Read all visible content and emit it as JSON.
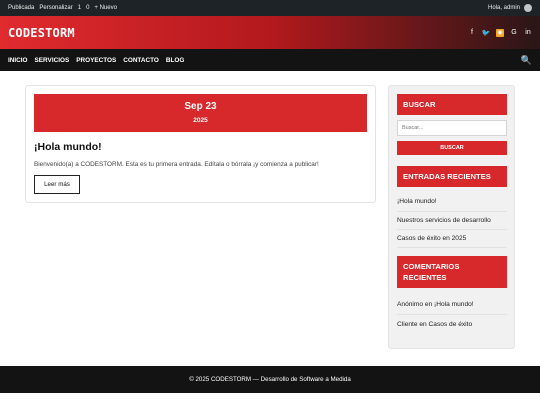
{
  "adminbar": {
    "items": [
      "Publicada",
      "Personalizar",
      "1",
      "0",
      "+ Nuevo"
    ],
    "greeting": "Hola, admin"
  },
  "brand": {
    "logo": "CODESTORM",
    "social": [
      {
        "icon": "facebook-icon",
        "glyph": "f"
      },
      {
        "icon": "twitter-icon",
        "glyph": "🐦"
      },
      {
        "icon": "rss-icon",
        "glyph": "◉"
      },
      {
        "icon": "google-icon",
        "glyph": "G"
      },
      {
        "icon": "linkedin-icon",
        "glyph": "in"
      }
    ]
  },
  "nav": {
    "items": [
      "INICIO",
      "SERVICIOS",
      "PROYECTOS",
      "CONTACTO",
      "BLOG"
    ],
    "search_glyph": "🔍"
  },
  "post": {
    "date_day": "Sep 23",
    "date_year": "2025",
    "title": "¡Hola mundo!",
    "excerpt": "Bienvenido(a) a CODESTORM. Esta es tu primera entrada. Edítala o bórrala ¡y comienza a publicar!",
    "read_more": "Leer más"
  },
  "sidebar": {
    "search_title": "BUSCAR",
    "search_placeholder": "Buscar...",
    "search_button": "BUSCAR",
    "recent_title": "ENTRADAS RECIENTES",
    "recent_posts": [
      "¡Hola mundo!",
      "Nuestros servicios de desarrollo",
      "Casos de éxito en 2025"
    ],
    "comments_title": "COMENTARIOS RECIENTES",
    "comments": [
      "Anónimo en ¡Hola mundo!",
      "Cliente en Casos de éxito"
    ]
  },
  "footer": {
    "text": "© 2025 CODESTORM — Desarrollo de Software a Medida"
  },
  "colors": {
    "accent": "#d7282c",
    "nav_bg": "#131313",
    "admin_bg": "#1d2327"
  }
}
